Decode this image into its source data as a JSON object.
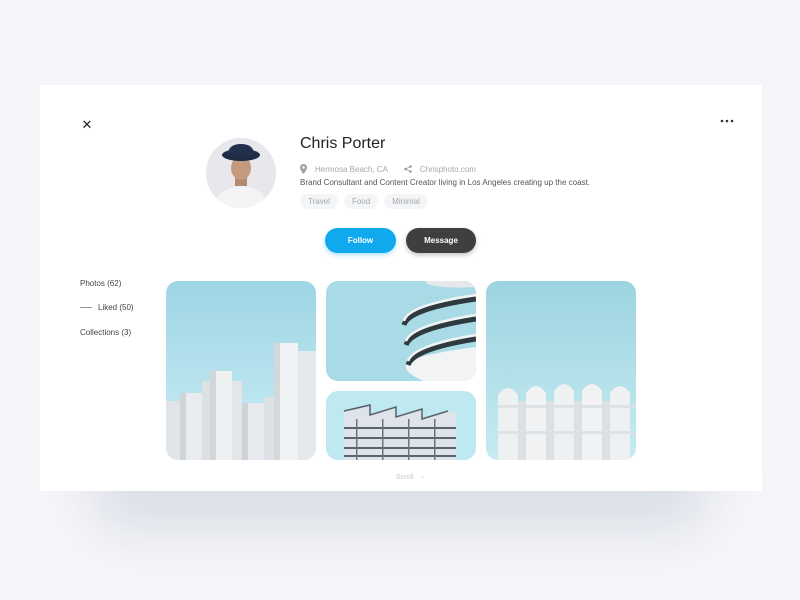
{
  "profile": {
    "name": "Chris Porter",
    "location": "Hermosa Beach, CA",
    "website": "Chrisphoto.com",
    "bio": "Brand Consultant and Content Creator living in Los Angeles creating up the coast.",
    "tags": [
      "Travel",
      "Food",
      "Minimal"
    ]
  },
  "actions": {
    "follow_label": "Follow",
    "message_label": "Message"
  },
  "nav": {
    "items": [
      {
        "label": "Photos (62)"
      },
      {
        "label": "Liked (50)"
      },
      {
        "label": "Collections (3)"
      }
    ]
  },
  "footer": {
    "scroll_label": "Scroll"
  },
  "colors": {
    "accent": "#11a9ee",
    "dark_button": "#3f3f3f",
    "sky": "#a9dbe6"
  },
  "icons": {
    "close": "close-icon",
    "more": "more-horizontal-icon",
    "location": "location-pin-icon",
    "share": "share-icon",
    "scroll": "chevron-right-icon"
  }
}
